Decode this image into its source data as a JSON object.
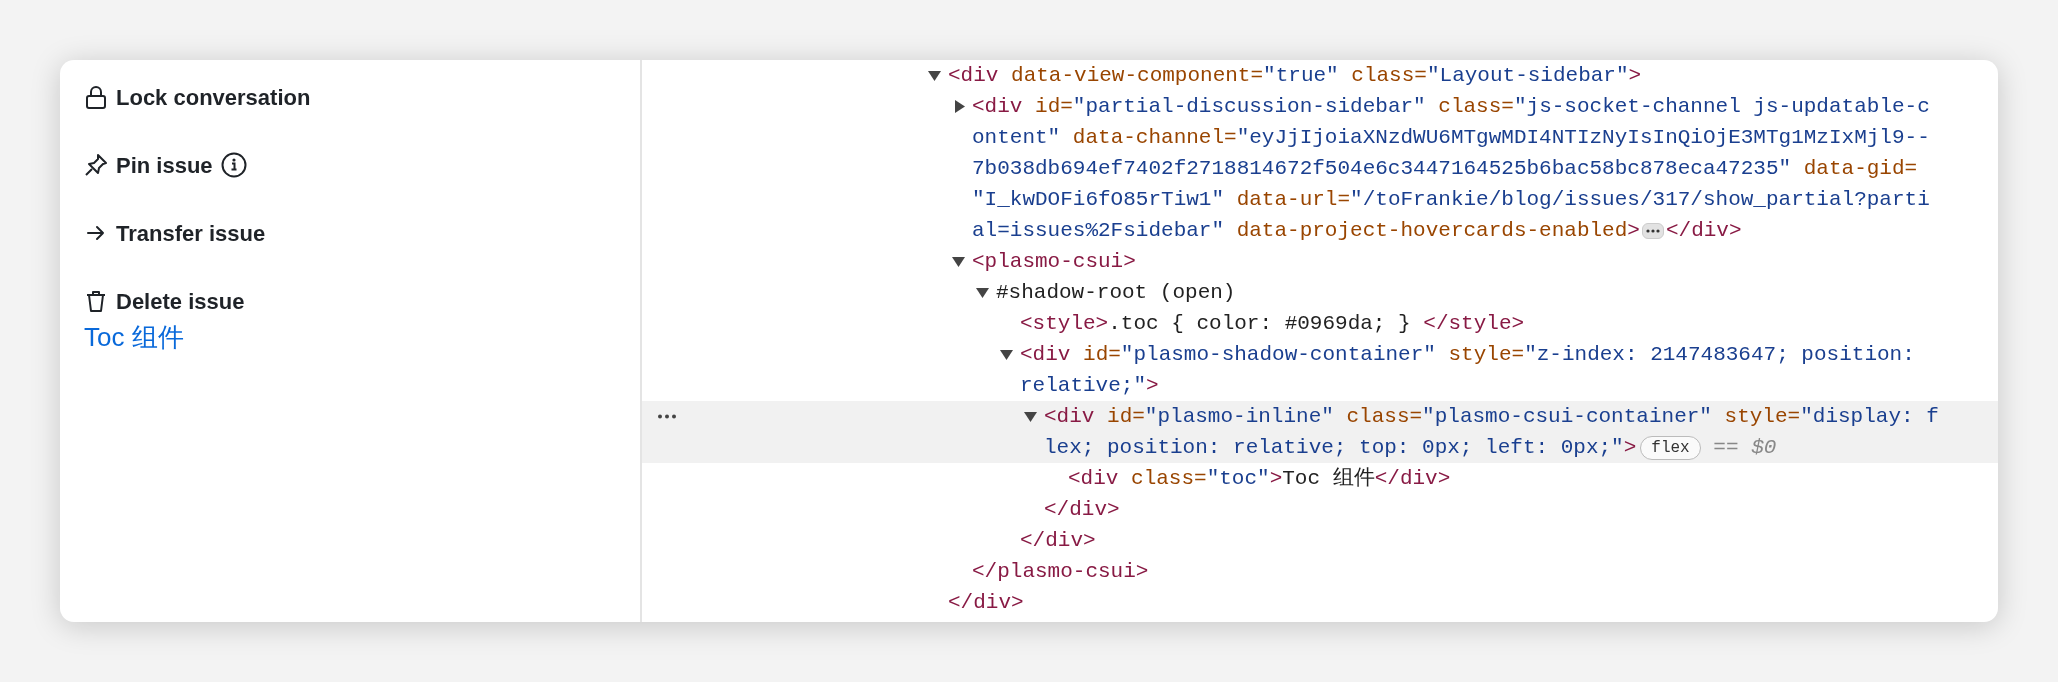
{
  "actions": [
    {
      "label": "Lock conversation"
    },
    {
      "label": "Pin issue"
    },
    {
      "label": "Transfer issue"
    },
    {
      "label": "Delete issue"
    }
  ],
  "toc_link": "Toc 组件",
  "tree": [
    {
      "expanded": true,
      "selected": false,
      "lines": [
        [
          {
            "kind": "tag",
            "text": "<div"
          },
          {
            "kind": "attr",
            "text": " data-view-component="
          },
          {
            "kind": "value",
            "text": "\"true\""
          },
          {
            "kind": "attr",
            "text": " class="
          },
          {
            "kind": "value",
            "text": "\"Layout-sidebar\""
          },
          {
            "kind": "tag",
            "text": ">"
          }
        ]
      ],
      "children": [
        {
          "expanded": false,
          "selected": false,
          "lines": [
            [
              {
                "kind": "tag",
                "text": "<div"
              },
              {
                "kind": "attr",
                "text": " id="
              },
              {
                "kind": "value",
                "text": "\"partial-discussion-sidebar\""
              },
              {
                "kind": "attr",
                "text": " class="
              },
              {
                "kind": "value",
                "text": "\"js-socket-channel js-updatable-c"
              }
            ],
            [
              {
                "kind": "value",
                "text": "ontent\""
              },
              {
                "kind": "attr",
                "text": " data-channel="
              },
              {
                "kind": "value",
                "text": "\"eyJjIjoiaXNzdWU6MTgwMDI4NTIzNyIsInQiOjE3MTg1MzIxMjl9--"
              }
            ],
            [
              {
                "kind": "value",
                "text": "7b038db694ef7402f2718814672f504e6c3447164525b6bac58bc878eca47235\""
              },
              {
                "kind": "attr",
                "text": " data-gid="
              }
            ],
            [
              {
                "kind": "value",
                "text": "\"I_kwDOFi6fO85rTiw1\""
              },
              {
                "kind": "attr",
                "text": " data-url="
              },
              {
                "kind": "value",
                "text": "\"/toFrankie/blog/issues/317/show_partial?parti"
              }
            ],
            [
              {
                "kind": "value",
                "text": "al=issues%2Fsidebar\""
              },
              {
                "kind": "attr",
                "text": " data-project-hovercards-enabled"
              },
              {
                "kind": "tag",
                "text": ">"
              },
              {
                "kind": "ellipsis"
              },
              {
                "kind": "tag",
                "text": "</div>"
              }
            ]
          ]
        },
        {
          "expanded": true,
          "selected": false,
          "lines": [
            [
              {
                "kind": "tag",
                "text": "<plasmo-csui>"
              }
            ]
          ],
          "children": [
            {
              "expanded": true,
              "selected": false,
              "lines": [
                [
                  {
                    "kind": "text",
                    "text": "#shadow-root (open)"
                  }
                ]
              ],
              "children": [
                {
                  "selected": false,
                  "lines": [
                    [
                      {
                        "kind": "tag",
                        "text": "<style>"
                      },
                      {
                        "kind": "text",
                        "text": ".toc { color: #0969da; } "
                      },
                      {
                        "kind": "tag",
                        "text": "</style>"
                      }
                    ]
                  ]
                },
                {
                  "expanded": true,
                  "selected": false,
                  "lines": [
                    [
                      {
                        "kind": "tag",
                        "text": "<div"
                      },
                      {
                        "kind": "attr",
                        "text": " id="
                      },
                      {
                        "kind": "value",
                        "text": "\"plasmo-shadow-container\""
                      },
                      {
                        "kind": "attr",
                        "text": " style="
                      },
                      {
                        "kind": "value",
                        "text": "\"z-index: 2147483647; position:"
                      }
                    ],
                    [
                      {
                        "kind": "value",
                        "text": "relative;\""
                      },
                      {
                        "kind": "tag",
                        "text": ">"
                      }
                    ]
                  ],
                  "children": [
                    {
                      "expanded": true,
                      "selected": true,
                      "lines": [
                        [
                          {
                            "kind": "tag",
                            "text": "<div"
                          },
                          {
                            "kind": "attr",
                            "text": " id="
                          },
                          {
                            "kind": "value",
                            "text": "\"plasmo-inline\""
                          },
                          {
                            "kind": "attr",
                            "text": " class="
                          },
                          {
                            "kind": "value",
                            "text": "\"plasmo-csui-container\""
                          },
                          {
                            "kind": "attr",
                            "text": " style="
                          },
                          {
                            "kind": "value",
                            "text": "\"display: f"
                          }
                        ],
                        [
                          {
                            "kind": "value",
                            "text": "lex; position: relative; top: 0px; left: 0px;\""
                          },
                          {
                            "kind": "tag",
                            "text": ">"
                          },
                          {
                            "kind": "badge",
                            "text": "flex"
                          },
                          {
                            "kind": "marker",
                            "text": " == "
                          },
                          {
                            "kind": "var",
                            "text": "$0"
                          }
                        ]
                      ],
                      "children": [
                        {
                          "selected": false,
                          "lines": [
                            [
                              {
                                "kind": "tag",
                                "text": "<div"
                              },
                              {
                                "kind": "attr",
                                "text": " class="
                              },
                              {
                                "kind": "value",
                                "text": "\"toc\""
                              },
                              {
                                "kind": "tag",
                                "text": ">"
                              },
                              {
                                "kind": "text",
                                "text": "Toc 组件"
                              },
                              {
                                "kind": "tag",
                                "text": "</div>"
                              }
                            ]
                          ]
                        }
                      ],
                      "close": "</div>"
                    }
                  ],
                  "close": "</div>"
                }
              ]
            }
          ],
          "close": "</plasmo-csui>"
        }
      ],
      "close": "</div>"
    }
  ]
}
